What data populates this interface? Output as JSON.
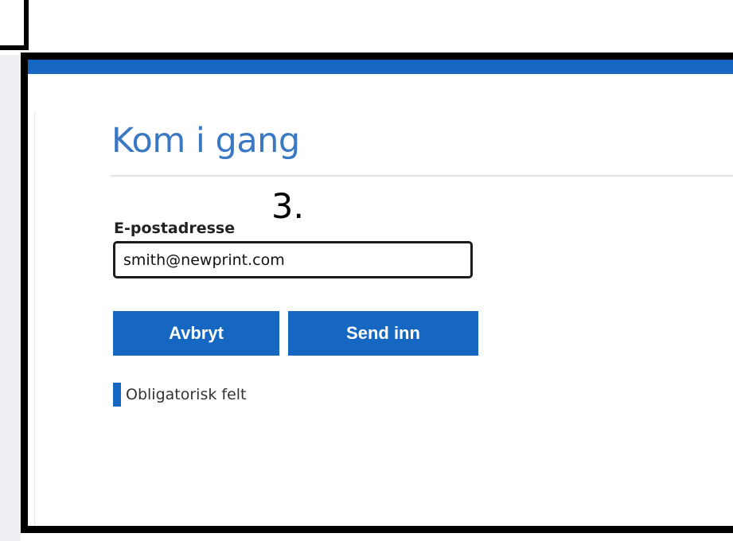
{
  "page": {
    "heading": "Kom i gang",
    "step_marker": "3."
  },
  "form": {
    "email_label": "E-postadresse",
    "email_value": "smith@newprint.com",
    "cancel_label": "Avbryt",
    "submit_label": "Send inn",
    "required_note": "Obligatorisk felt"
  },
  "colors": {
    "accent": "#1567c2",
    "heading": "#3a78c4",
    "sidebar_bg": "#eeeef3"
  }
}
